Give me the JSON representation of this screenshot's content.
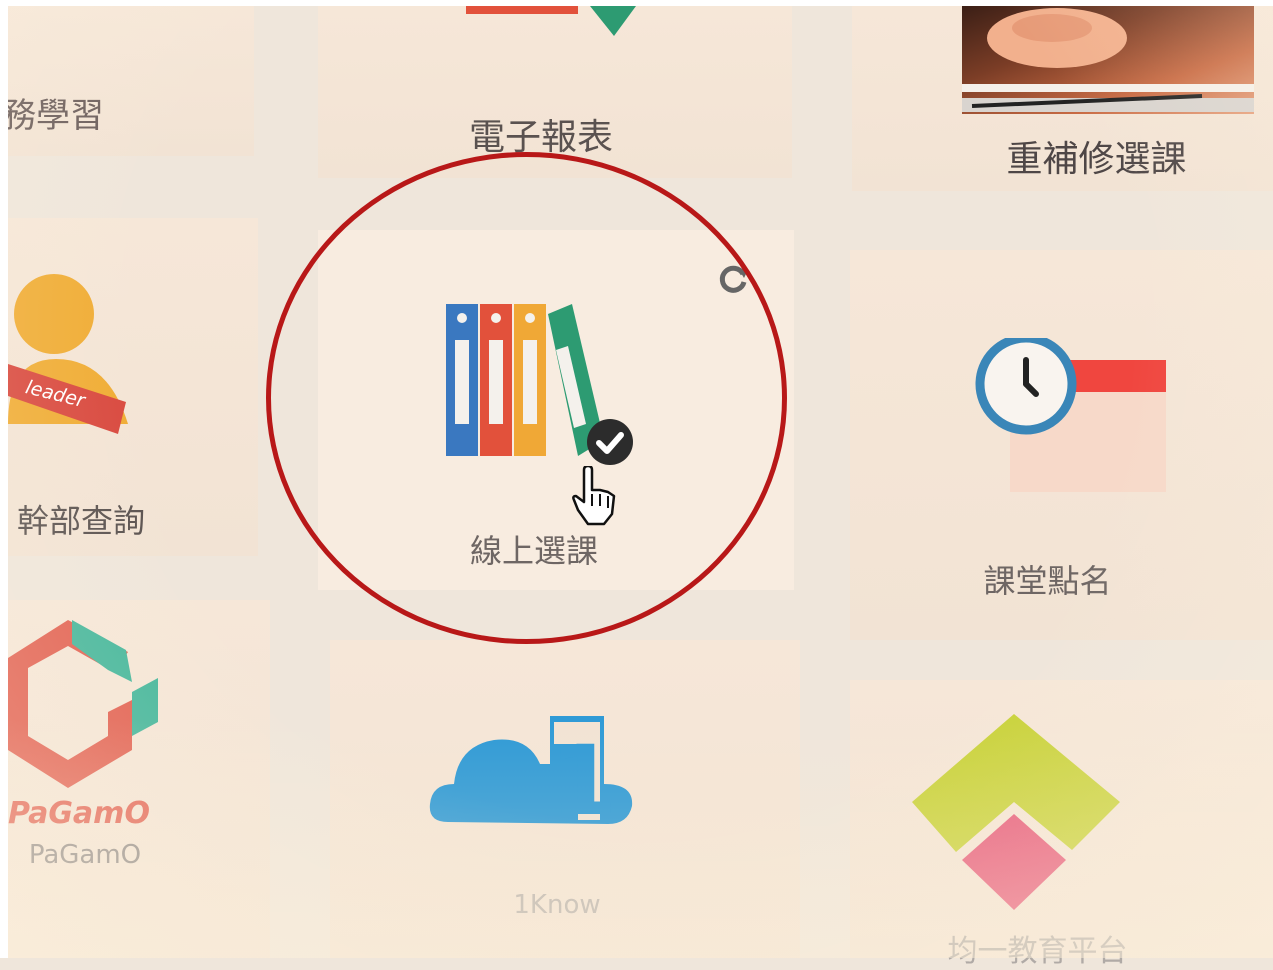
{
  "tiles": {
    "duty_learning": {
      "label": "務學習"
    },
    "e_report": {
      "label": "電子報表"
    },
    "repeat_course": {
      "label": "重補修選課"
    },
    "cadre_query": {
      "label": "幹部查詢",
      "badge_text": "leader"
    },
    "online_course": {
      "label": "線上選課"
    },
    "class_rollcall": {
      "label": "課堂點名"
    },
    "pagamo": {
      "label": "PaGamO",
      "logo_text": "PaGamO"
    },
    "oneknow": {
      "label": "1Know",
      "logo_text": "1"
    },
    "junyi": {
      "label": "均一教育平台"
    }
  },
  "colors": {
    "ring": "#b81818",
    "binder_blue": "#3a78c0",
    "binder_red": "#e2513b",
    "binder_yellow": "#f0a836",
    "binder_green": "#2d9b72",
    "cloud_blue": "#2f9ad6",
    "pagamo_red": "#e26253",
    "pagamo_green": "#46b79c",
    "junyi_yellow": "#c9d23a",
    "junyi_pink": "#e65a7a",
    "clock_blue": "#3a86b8",
    "calendar_red": "#f0463f"
  },
  "icons": {
    "refresh": "refresh-icon",
    "check": "check-circle-icon",
    "cursor": "hand-pointer-icon"
  }
}
